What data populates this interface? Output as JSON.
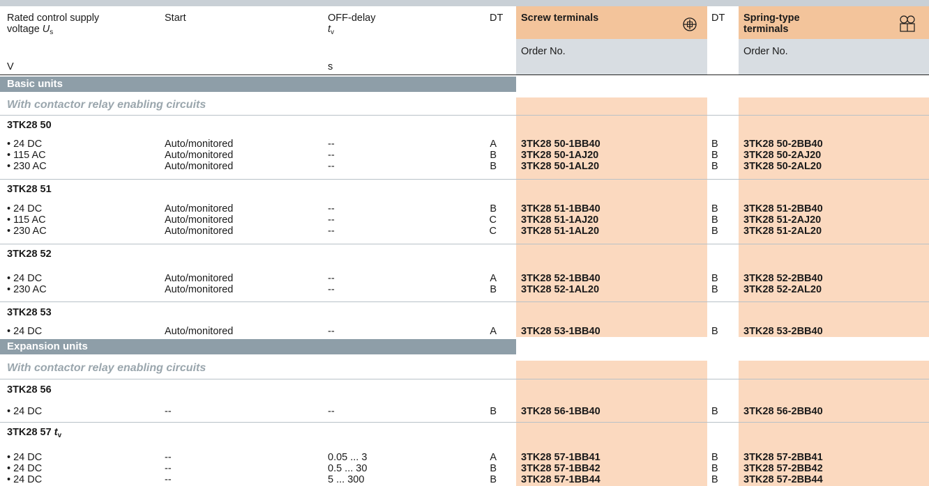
{
  "header": {
    "voltage_line1": "Rated control supply",
    "voltage_line2": "voltage ",
    "voltage_sym": "U",
    "voltage_sub": "s",
    "voltage_unit": "V",
    "start": "Start",
    "offdelay_line1": "OFF-delay",
    "offdelay_sym": "t",
    "offdelay_sub": "v",
    "offdelay_unit": "s",
    "dt1": "DT",
    "screw_title": "Screw terminals",
    "screw_order": "Order No.",
    "dt2": "DT",
    "spring_title_line1": "Spring-type",
    "spring_title_line2": "terminals",
    "spring_order": "Order No."
  },
  "sections": {
    "basic": "Basic units",
    "basic_sub": "With contactor relay enabling circuits",
    "expansion": "Expansion units",
    "expansion_sub": "With contactor relay enabling circuits"
  },
  "groups": {
    "g1": "3TK28 50",
    "g2": "3TK28 51",
    "g3": "3TK28 52",
    "g4": "3TK28 53",
    "g5": "3TK28 56",
    "g6_main": "3TK28 57 ",
    "g6_sym": "t",
    "g6_sub": "v"
  },
  "rows": [
    {
      "v": "• 24 DC",
      "start": "Auto/monitored",
      "off": "--",
      "dt1": "A",
      "screw": "3TK28 50-1BB40",
      "dt2": "B",
      "spring": "3TK28 50-2BB40"
    },
    {
      "v": "• 115 AC",
      "start": "Auto/monitored",
      "off": "--",
      "dt1": "B",
      "screw": "3TK28 50-1AJ20",
      "dt2": "B",
      "spring": "3TK28 50-2AJ20"
    },
    {
      "v": "• 230 AC",
      "start": "Auto/monitored",
      "off": "--",
      "dt1": "B",
      "screw": "3TK28 50-1AL20",
      "dt2": "B",
      "spring": "3TK28 50-2AL20"
    },
    {
      "v": "• 24 DC",
      "start": "Auto/monitored",
      "off": "--",
      "dt1": "B",
      "screw": "3TK28 51-1BB40",
      "dt2": "B",
      "spring": "3TK28 51-2BB40"
    },
    {
      "v": "• 115 AC",
      "start": "Auto/monitored",
      "off": "--",
      "dt1": "C",
      "screw": "3TK28 51-1AJ20",
      "dt2": "B",
      "spring": "3TK28 51-2AJ20"
    },
    {
      "v": "• 230 AC",
      "start": "Auto/monitored",
      "off": "--",
      "dt1": "C",
      "screw": "3TK28 51-1AL20",
      "dt2": "B",
      "spring": "3TK28 51-2AL20"
    },
    {
      "v": "• 24 DC",
      "start": "Auto/monitored",
      "off": "--",
      "dt1": "A",
      "screw": "3TK28 52-1BB40",
      "dt2": "B",
      "spring": "3TK28 52-2BB40"
    },
    {
      "v": "• 230 AC",
      "start": "Auto/monitored",
      "off": "--",
      "dt1": "B",
      "screw": "3TK28 52-1AL20",
      "dt2": "B",
      "spring": "3TK28 52-2AL20"
    },
    {
      "v": "• 24 DC",
      "start": "Auto/monitored",
      "off": "--",
      "dt1": "A",
      "screw": "3TK28 53-1BB40",
      "dt2": "B",
      "spring": "3TK28 53-2BB40"
    },
    {
      "v": "• 24 DC",
      "start": "--",
      "off": "--",
      "dt1": "B",
      "screw": "3TK28 56-1BB40",
      "dt2": "B",
      "spring": "3TK28 56-2BB40"
    },
    {
      "v": "• 24 DC",
      "start": "--",
      "off": "0.05 ... 3",
      "dt1": "A",
      "screw": "3TK28 57-1BB41",
      "dt2": "B",
      "spring": "3TK28 57-2BB41"
    },
    {
      "v": "• 24 DC",
      "start": "--",
      "off": "0.5 ... 30",
      "dt1": "B",
      "screw": "3TK28 57-1BB42",
      "dt2": "B",
      "spring": "3TK28 57-2BB42"
    },
    {
      "v": "• 24 DC",
      "start": "--",
      "off": "5 ... 300",
      "dt1": "B",
      "screw": "3TK28 57-1BB44",
      "dt2": "B",
      "spring": "3TK28 57-2BB44"
    }
  ],
  "colors": {
    "header_orange": "#f3c49b",
    "cell_orange": "#fbd9bf",
    "section_gray": "#8e9ea8",
    "subhead_gray": "#9aa6ad"
  },
  "icons": {
    "screw": "screw-terminal-icon",
    "spring": "spring-terminal-icon"
  }
}
